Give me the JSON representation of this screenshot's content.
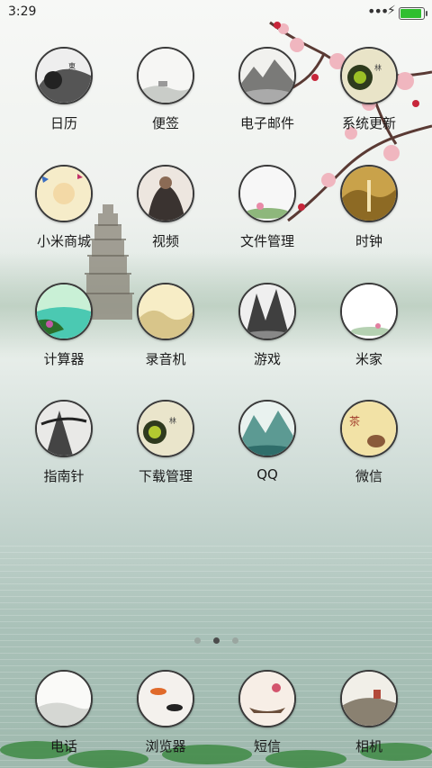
{
  "status_bar": {
    "time": "3:29",
    "more": "•••",
    "charging": "⚡",
    "battery_level": 1.0
  },
  "apps": [
    {
      "label": "日历",
      "art": "ink-calendar"
    },
    {
      "label": "便签",
      "art": "mist-pavilion"
    },
    {
      "label": "电子邮件",
      "art": "ink-mountain"
    },
    {
      "label": "系统更新",
      "art": "green-circle"
    },
    {
      "label": "小米商城",
      "art": "peach-bird"
    },
    {
      "label": "视频",
      "art": "figure-painting"
    },
    {
      "label": "文件管理",
      "art": "lotus-pink"
    },
    {
      "label": "时钟",
      "art": "gold-waterfall"
    },
    {
      "label": "计算器",
      "art": "green-lake"
    },
    {
      "label": "录音机",
      "art": "pale-hills"
    },
    {
      "label": "游戏",
      "art": "dark-peaks"
    },
    {
      "label": "米家",
      "art": "white-lotus"
    },
    {
      "label": "指南针",
      "art": "pine-ink"
    },
    {
      "label": "下载管理",
      "art": "green-circle-2"
    },
    {
      "label": "QQ",
      "art": "blue-mountain"
    },
    {
      "label": "微信",
      "art": "teapot"
    }
  ],
  "dock": [
    {
      "label": "电话",
      "art": "white-mist"
    },
    {
      "label": "浏览器",
      "art": "koi-fish"
    },
    {
      "label": "短信",
      "art": "flower-boat"
    },
    {
      "label": "相机",
      "art": "ink-scene"
    }
  ],
  "pager": {
    "pages": 3,
    "active_page": 2
  }
}
